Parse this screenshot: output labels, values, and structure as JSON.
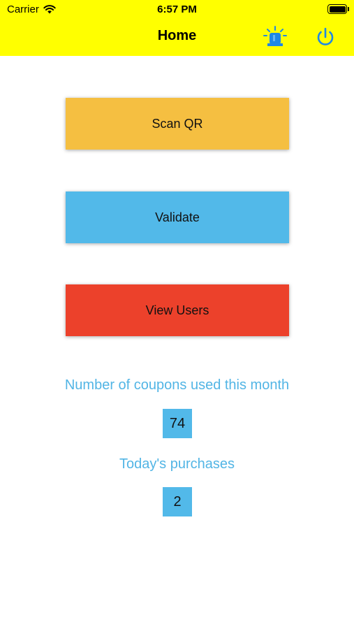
{
  "status_bar": {
    "carrier": "Carrier",
    "time": "6:57 PM"
  },
  "nav": {
    "title": "Home",
    "left_action_icon": "alarm-siren-icon",
    "right_action_icon": "power-icon"
  },
  "buttons": {
    "scan_qr": "Scan QR",
    "validate": "Validate",
    "view_users": "View Users"
  },
  "stats": {
    "coupons_label": "Number of coupons used this month",
    "coupons_value": "74",
    "purchases_label": "Today's purchases",
    "purchases_value": "2"
  },
  "colors": {
    "header": "#ffff00",
    "scan_qr": "#f5bf41",
    "validate": "#52b9e9",
    "view_users": "#ec412b",
    "accent": "#52b5e5"
  }
}
